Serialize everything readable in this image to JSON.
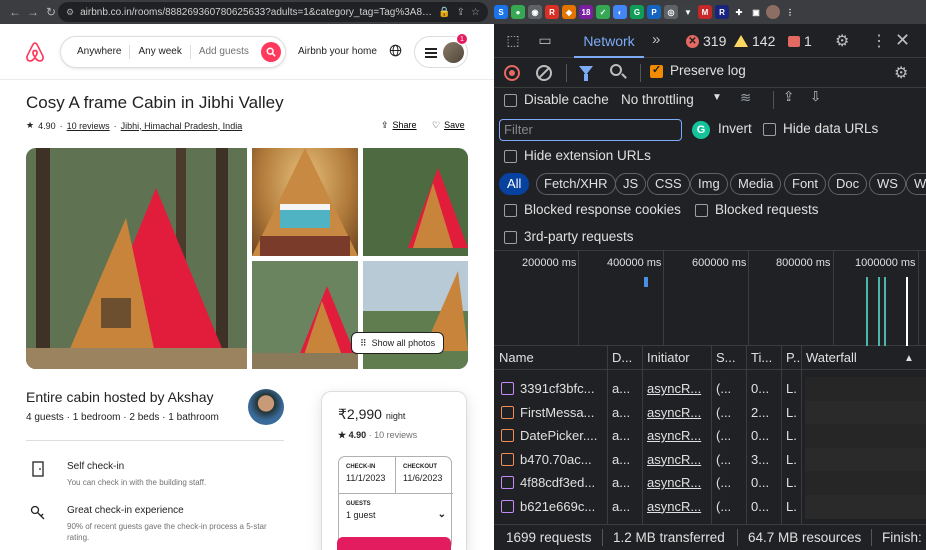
{
  "browser": {
    "url": "airbnb.co.in/rooms/888269360780625633?adults=1&category_tag=Tag%3A818..."
  },
  "airbnb": {
    "search": {
      "anywhere": "Anywhere",
      "any_week": "Any week",
      "add_guests": "Add guests"
    },
    "host_link": "Airbnb your home",
    "notification_count": "1",
    "title": "Cosy A frame Cabin in Jibhi Valley",
    "rating": "4.90",
    "reviews": "10 reviews",
    "location": "Jibhi, Himachal Pradesh, India",
    "share": "Share",
    "save": "Save",
    "show_all_photos": "Show all photos",
    "hosted_by": "Entire cabin hosted by Akshay",
    "specs": "4 guests · 1 bedroom · 2 beds · 1 bathroom",
    "features": [
      {
        "title": "Self check-in",
        "sub": "You can check in with the building staff."
      },
      {
        "title": "Great check-in experience",
        "sub": "90% of recent guests gave the check-in process a 5-star rating."
      }
    ],
    "booking": {
      "price": "₹2,990",
      "per": "night",
      "rating": "4.90",
      "reviews": "10 reviews",
      "checkin_label": "CHECK-IN",
      "checkin": "11/1/2023",
      "checkout_label": "CHECKOUT",
      "checkout": "11/6/2023",
      "guests_label": "GUESTS",
      "guests": "1 guest"
    }
  },
  "devtools": {
    "tab": "Network",
    "errors": "319",
    "warnings": "142",
    "issues": "1",
    "preserve_log": "Preserve log",
    "disable_cache": "Disable cache",
    "throttling": "No throttling",
    "filter_placeholder": "Filter",
    "invert": "Invert",
    "hide_data_urls": "Hide data URLs",
    "hide_extension_urls": "Hide extension URLs",
    "types": [
      "All",
      "Fetch/XHR",
      "JS",
      "CSS",
      "Img",
      "Media",
      "Font",
      "Doc",
      "WS",
      "W"
    ],
    "blocked_cookies": "Blocked response cookies",
    "blocked_requests": "Blocked requests",
    "third_party": "3rd-party requests",
    "overview_ticks": [
      "200000 ms",
      "400000 ms",
      "600000 ms",
      "800000 ms",
      "1000000 ms"
    ],
    "columns": [
      "Name",
      "D...",
      "Initiator",
      "S...",
      "Ti...",
      "P...",
      "Waterfall"
    ],
    "rows": [
      {
        "type": "img",
        "name": "3391cf3bfc...",
        "domain": "a...",
        "initiator": "asyncR...",
        "status": "(...",
        "time": "0...",
        "priority": "L..."
      },
      {
        "type": "js",
        "name": "FirstMessa...",
        "domain": "a...",
        "initiator": "asyncR...",
        "status": "(...",
        "time": "2...",
        "priority": "L..."
      },
      {
        "type": "js",
        "name": "DatePicker....",
        "domain": "a...",
        "initiator": "asyncR...",
        "status": "(...",
        "time": "0...",
        "priority": "L..."
      },
      {
        "type": "js",
        "name": "b470.70ac...",
        "domain": "a...",
        "initiator": "asyncR...",
        "status": "(...",
        "time": "3...",
        "priority": "L..."
      },
      {
        "type": "img",
        "name": "4f88cdf3ed...",
        "domain": "a...",
        "initiator": "asyncR...",
        "status": "(...",
        "time": "0...",
        "priority": "L..."
      },
      {
        "type": "img",
        "name": "b621e669c...",
        "domain": "a...",
        "initiator": "asyncR...",
        "status": "(...",
        "time": "0...",
        "priority": "L..."
      }
    ],
    "status": {
      "requests": "1699 requests",
      "transferred": "1.2 MB transferred",
      "resources": "64.7 MB resources",
      "finish": "Finish:"
    }
  }
}
